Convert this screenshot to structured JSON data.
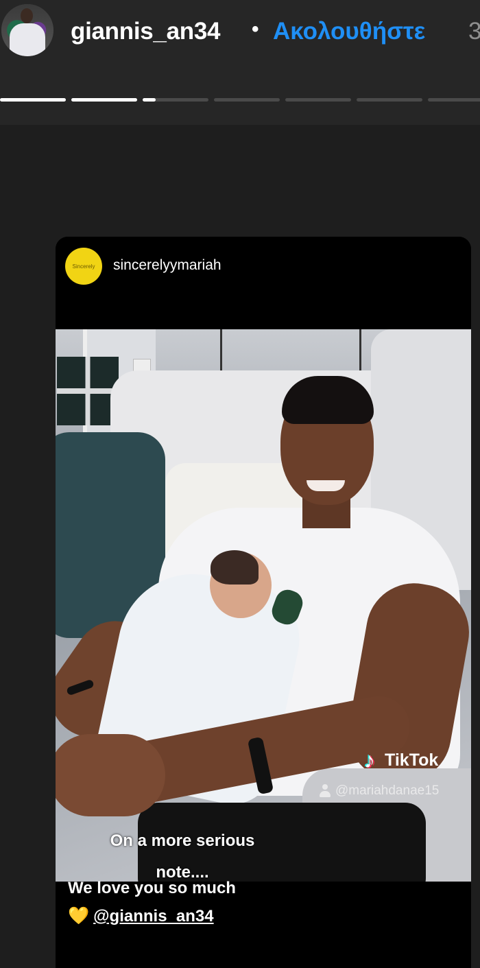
{
  "header": {
    "username": "giannis_an34",
    "separator": "•",
    "follow_label": "Ακολουθήστε",
    "time_label": "3"
  },
  "progress": {
    "segments": 7,
    "active_index": 2,
    "active_fraction": 0.2
  },
  "embedded_post": {
    "author": "sincerelyymariah",
    "author_avatar_text": "Sincerely",
    "tiktok_label": "TikTok",
    "tiktok_handle": "@mariahdanae15",
    "overlay_caption_line1": "On a more serious",
    "overlay_caption_line2": "note....",
    "caption_line1": "We love you so much",
    "caption_mention": "@giannis_an34"
  },
  "colors": {
    "background": "#262626",
    "follow_blue": "#1f8ff5",
    "avatar_yellow": "#f1d414",
    "heart": "#f4c430"
  },
  "icons": {
    "heart": "💛"
  }
}
